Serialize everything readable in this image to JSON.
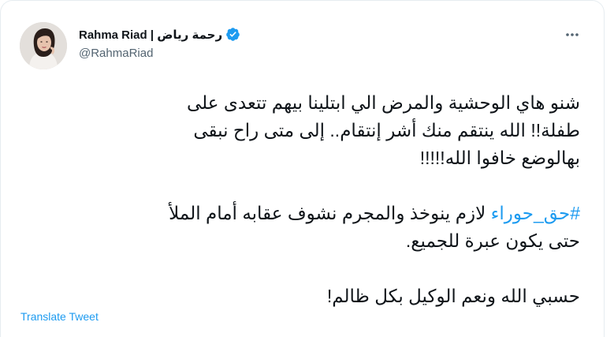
{
  "author": {
    "display_name": "Rahma Riad | رحمة رياض",
    "handle": "@RahmaRiad",
    "verified": true,
    "verified_icon": "verified-badge-icon"
  },
  "tweet": {
    "paragraph1": {
      "line1": "شنو هاي الوحشية والمرض الي ابتلينا بيهم تتعدى على",
      "line2": "طفلة!! الله ينتقم منك أشر إنتقام.. إلى متى راح نبقى",
      "line3": "بهالوضع خافوا الله!!!!!"
    },
    "paragraph2": {
      "hashtag": "#حق_حوراء",
      "line1_rest": " لازم ينوخذ والمجرم نشوف عقابه أمام الملأ",
      "line2": "حتى يكون عبرة للجميع."
    },
    "paragraph3": {
      "line1": "حسبي الله ونعم الوكيل بكل ظالم!"
    }
  },
  "actions": {
    "translate_label": "Translate Tweet",
    "more_icon": "more-options-icon"
  },
  "colors": {
    "accent": "#1d9bf0",
    "text": "#0f1419",
    "secondary": "#536471"
  }
}
